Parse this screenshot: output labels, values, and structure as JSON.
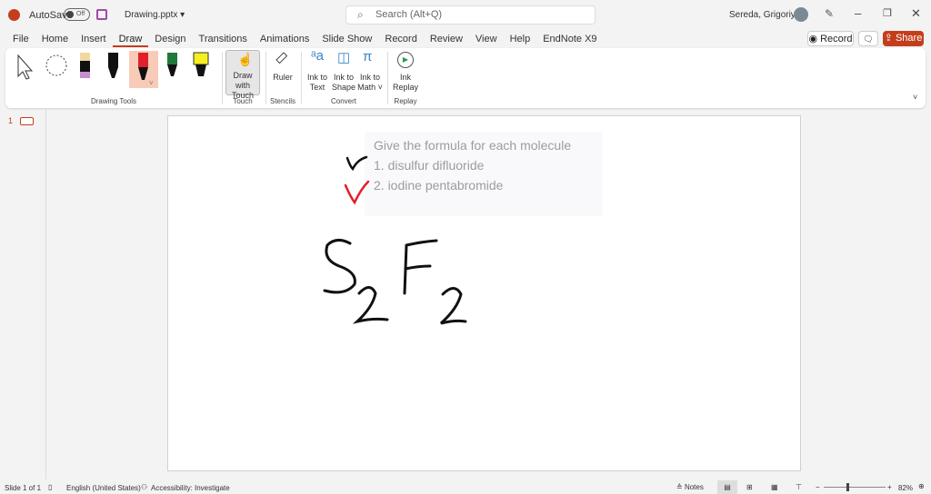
{
  "title": {
    "autosave": "AutoSave",
    "toggle": "Off",
    "filename": "Drawing.pptx ▾",
    "search_placeholder": "Search (Alt+Q)",
    "user": "Sereda, Grigoriy A"
  },
  "menu": [
    "File",
    "Home",
    "Insert",
    "Draw",
    "Design",
    "Transitions",
    "Animations",
    "Slide Show",
    "Record",
    "Review",
    "View",
    "Help",
    "EndNote X9"
  ],
  "actions": {
    "record": "Record",
    "share": "Share"
  },
  "ribbon": {
    "groups": {
      "drawing_tools": "Drawing Tools",
      "touch": "Touch",
      "stencils": "Stencils",
      "convert": "Convert",
      "replay": "Replay"
    },
    "draw_with_touch": "Draw with Touch",
    "ruler": "Ruler",
    "ink_to_text": "Ink to Text",
    "ink_to_shape": "Ink to Shape",
    "ink_to_math": "Ink to Math ˅",
    "ink_replay": "Ink Replay"
  },
  "thumb": {
    "number": "1"
  },
  "slide": {
    "heading": "Give the formula for each molecule",
    "items": [
      "1. disulfur difluoride",
      "2. iodine pentabromide"
    ]
  },
  "status": {
    "slide": "Slide 1 of 1",
    "language": "English (United States)",
    "accessibility": "Accessibility: Investigate",
    "notes": "Notes",
    "zoom": "82%"
  },
  "colors": {
    "accent": "#c43e1c",
    "ink_red": "#e0202a"
  }
}
